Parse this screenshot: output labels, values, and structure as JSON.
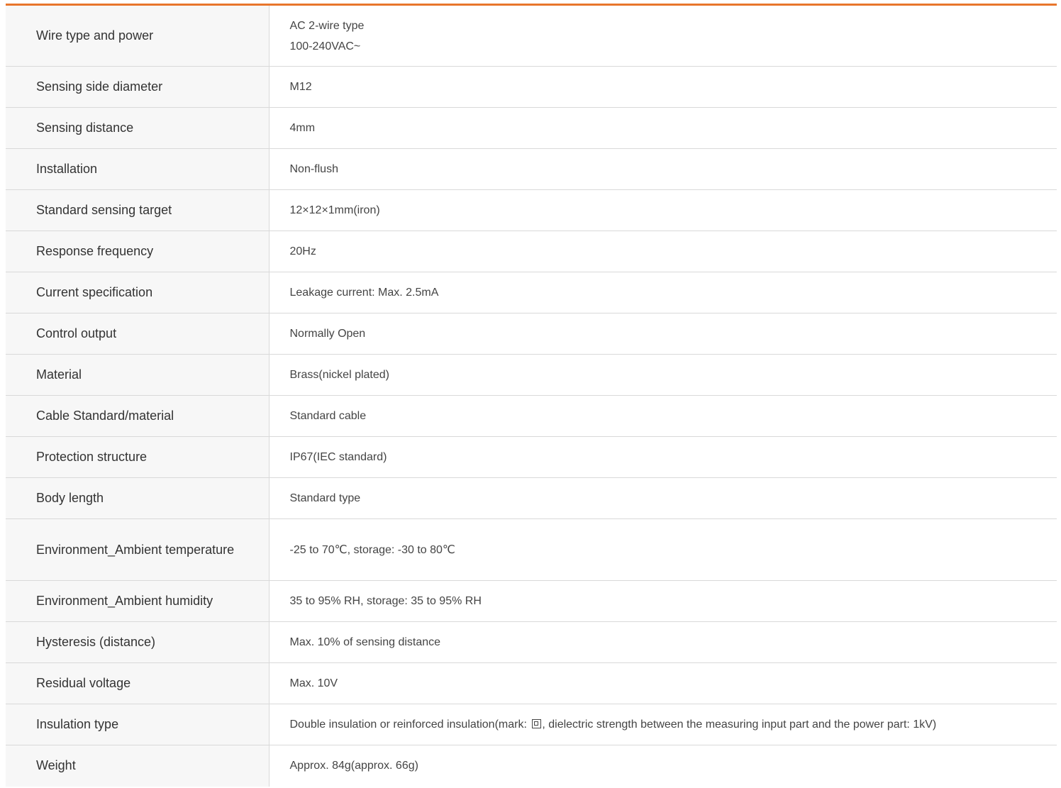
{
  "accent_color": "#e8762c",
  "specs": [
    {
      "label": "Wire type and power",
      "value_lines": [
        "AC 2-wire type",
        "100-240VAC~"
      ]
    },
    {
      "label": "Sensing side diameter",
      "value": "M12"
    },
    {
      "label": "Sensing distance",
      "value": "4mm"
    },
    {
      "label": "Installation",
      "value": "Non-flush"
    },
    {
      "label": "Standard sensing target",
      "value": "12×12×1mm(iron)"
    },
    {
      "label": "Response frequency",
      "value": "20Hz"
    },
    {
      "label": "Current specification",
      "value": "Leakage current: Max. 2.5mA"
    },
    {
      "label": "Control output",
      "value": "Normally Open"
    },
    {
      "label": "Material",
      "value": "Brass(nickel plated)"
    },
    {
      "label": "Cable Standard/material",
      "value": "Standard cable"
    },
    {
      "label": "Protection structure",
      "value": "IP67(IEC standard)"
    },
    {
      "label": "Body length",
      "value": "Standard type"
    },
    {
      "label": "Environment_Ambient temperature",
      "value": "-25 to 70℃, storage: -30 to 80℃"
    },
    {
      "label": "Environment_Ambient humidity",
      "value": "35 to 95% RH, storage: 35 to 95% RH"
    },
    {
      "label": "Hysteresis (distance)",
      "value": "Max. 10% of sensing distance"
    },
    {
      "label": "Residual voltage",
      "value": "Max. 10V"
    },
    {
      "label": "Insulation type",
      "value_before_mark": "Double insulation or reinforced insulation(mark: ",
      "mark_icon": "double-insulation-icon",
      "value_after_mark": ", dielectric strength between the measuring input part and the power part: 1kV)"
    },
    {
      "label": "Weight",
      "value": "Approx. 84g(approx. 66g)"
    }
  ]
}
